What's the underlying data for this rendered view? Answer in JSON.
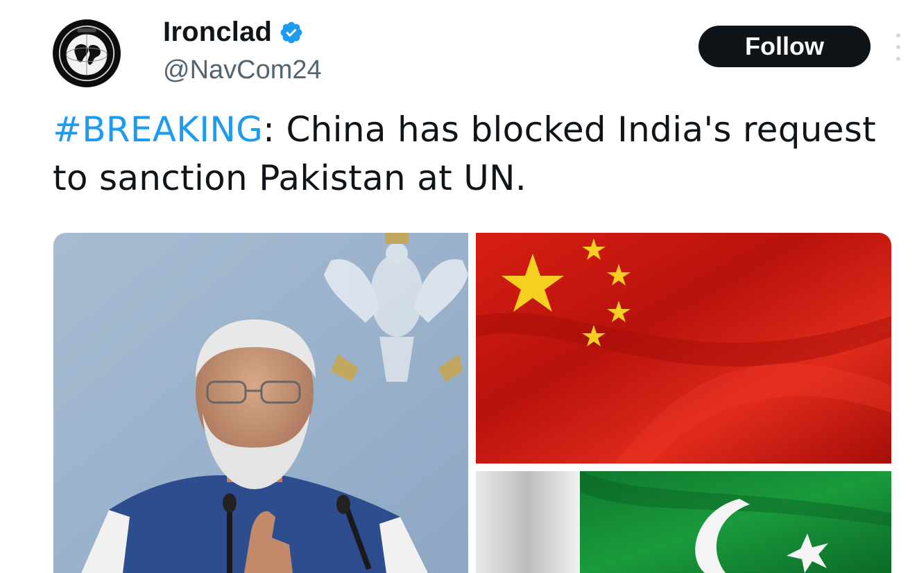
{
  "tweet": {
    "display_name": "Ironclad",
    "handle": "@NavCom24",
    "follow_label": "Follow",
    "hashtag": "#BREAKING",
    "text_rest": ": China has blocked India's request to sanction Pakistan at UN.",
    "verified": true
  },
  "icons": {
    "avatar": "globe-emblem",
    "verified": "verified-badge-icon",
    "more": "more-vertical-icon"
  },
  "colors": {
    "hashtag": "#1d9bf0",
    "follow_bg": "#0f1419",
    "verified": "#1d9bf0",
    "handle": "#536471"
  },
  "media": {
    "left": "photo-man-at-podium",
    "top_right": "china-flag",
    "bottom_right": "pakistan-flag"
  }
}
